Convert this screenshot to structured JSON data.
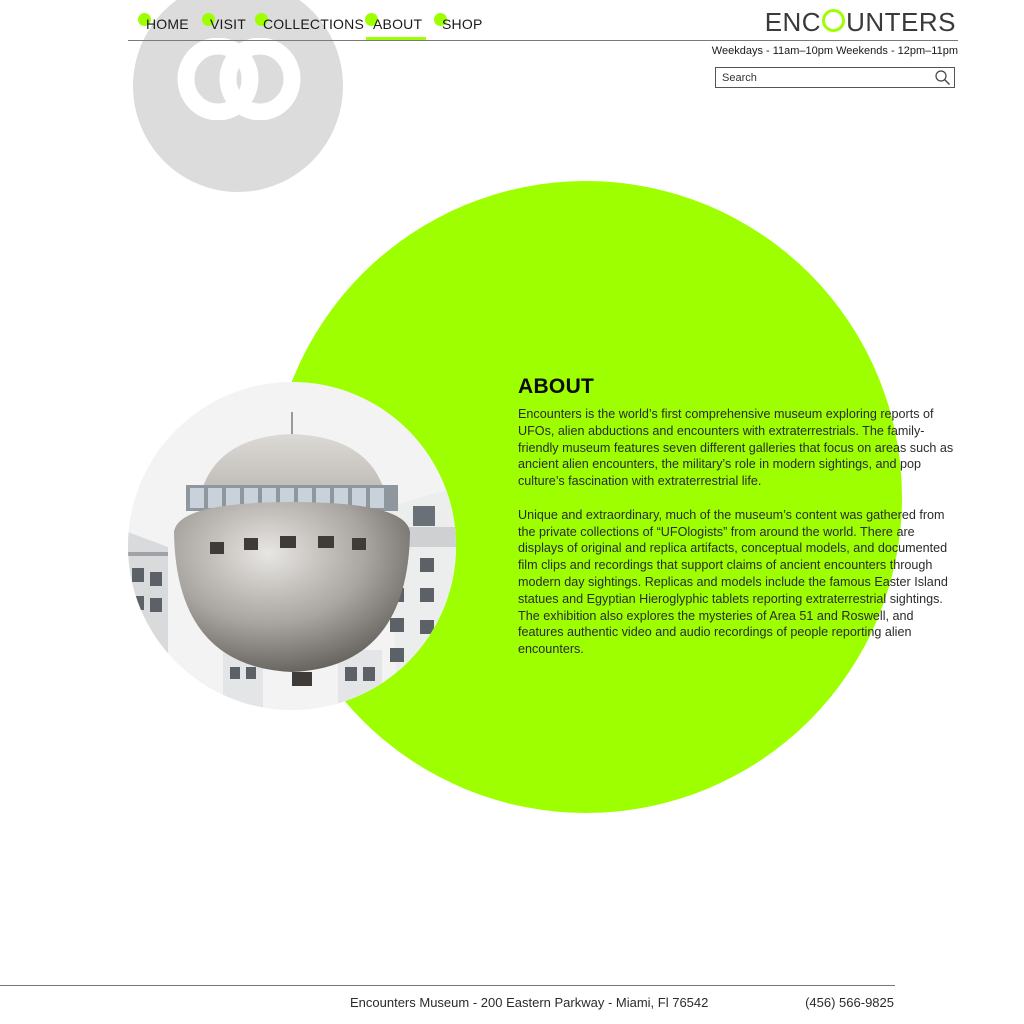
{
  "brand": {
    "name_prefix": "ENC",
    "name_suffix": "UNTERS",
    "accent_color": "#9dff00",
    "emblem_color": "#dcdcdc"
  },
  "nav": {
    "items": [
      {
        "label": "HOME",
        "active": false
      },
      {
        "label": "VISIT",
        "active": false
      },
      {
        "label": "COLLECTIONS",
        "active": false
      },
      {
        "label": "ABOUT",
        "active": true
      },
      {
        "label": "SHOP",
        "active": false
      }
    ]
  },
  "hours": "Weekdays - 11am–10pm Weekends - 12pm–11pm",
  "search": {
    "placeholder": "Search",
    "icon": "search-icon"
  },
  "about": {
    "title": "ABOUT",
    "paragraphs": [
      "Encounters is the world’s first comprehensive museum exploring reports of UFOs, alien abductions and encounters with extraterrestrials. The family-friendly museum features seven different galleries that focus on areas such as ancient alien encounters, the military’s role in modern sightings, and pop culture’s fascination with extraterrestrial life.",
      "Unique and extraordinary, much of the museum’s content was gathered from the private collections of “UFOlogists” from around the world. There are displays of original and replica artifacts, conceptual models, and documented film clips and recordings that support claims of ancient encounters through modern day sightings. Replicas and models include the famous Easter Island statues and Egyptian Hieroglyphic tablets reporting extraterrestrial sightings. The exhibition also explores the mysteries of Area 51 and Roswell, and features authentic video and audio recordings of people reporting alien encounters."
    ]
  },
  "footer": {
    "address": "Encounters Museum - 200 Eastern Parkway - Miami, Fl 76542",
    "phone": "(456) 566-9825"
  }
}
